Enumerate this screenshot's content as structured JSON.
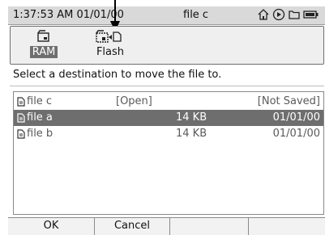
{
  "status": {
    "time": "1:37:53 AM 01/01/00",
    "title": "file c",
    "icons": [
      "home-icon",
      "play-icon",
      "folder-icon",
      "battery-icon"
    ]
  },
  "storage": {
    "ram_label": "RAM",
    "flash_label": "Flash",
    "selected": "RAM"
  },
  "instruction": "Select a destination to move the file to.",
  "files": [
    {
      "name": "file c",
      "col2": "[Open]",
      "size": "",
      "date": "[Not Saved]",
      "selected": false
    },
    {
      "name": "file a",
      "col2": "",
      "size": "14 KB",
      "date": "01/01/00",
      "selected": true
    },
    {
      "name": "file b",
      "col2": "",
      "size": "14 KB",
      "date": "01/01/00",
      "selected": false
    }
  ],
  "softkeys": {
    "ok": "OK",
    "cancel": "Cancel",
    "key3": "",
    "key4": ""
  },
  "colors": {
    "selection": "#6e6e6e",
    "statusbar": "#d9d9d9"
  }
}
